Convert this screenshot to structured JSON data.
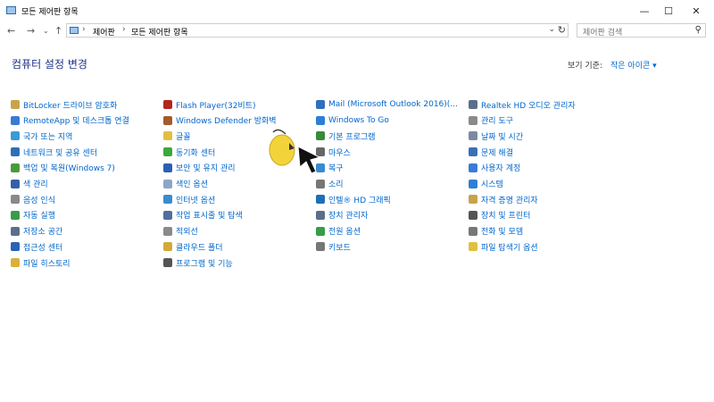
{
  "window": {
    "title": "모든 제어판 항목",
    "minimize": "—",
    "maximize": "☐",
    "close": "✕"
  },
  "address": {
    "crumbs": [
      "제어판",
      "모든 제어판 항목"
    ]
  },
  "search": {
    "placeholder": "제어판 검색"
  },
  "main": {
    "heading": "컴퓨터 설정 변경",
    "view_by_label": "보기 기준:",
    "view_by_value": "작은 아이콘 ▾"
  },
  "columns": [
    {
      "items": [
        {
          "label": "BitLocker 드라이브 암호화",
          "icon": "bitlocker-icon",
          "color": "#c8a34a"
        },
        {
          "label": "RemoteApp 및 데스크톱 연결",
          "icon": "remoteapp-icon",
          "color": "#3a7bd5"
        },
        {
          "label": "국가 또는 지역",
          "icon": "globe-icon",
          "color": "#3b9bd6"
        },
        {
          "label": "네트워크 및 공유 센터",
          "icon": "network-icon",
          "color": "#2f6fb8"
        },
        {
          "label": "백업 및 복원(Windows 7)",
          "icon": "backup-icon",
          "color": "#4a9a3c"
        },
        {
          "label": "색 관리",
          "icon": "color-management-icon",
          "color": "#3560a8"
        },
        {
          "label": "음성 인식",
          "icon": "microphone-icon",
          "color": "#8a8a8a"
        },
        {
          "label": "자동 실행",
          "icon": "autoplay-icon",
          "color": "#3a9b4a"
        },
        {
          "label": "저장소 공간",
          "icon": "storage-spaces-icon",
          "color": "#5b6f8a"
        },
        {
          "label": "접근성 센터",
          "icon": "ease-of-access-icon",
          "color": "#2a62b8"
        },
        {
          "label": "파일 히스토리",
          "icon": "file-history-icon",
          "color": "#d9b13a"
        }
      ]
    },
    {
      "items": [
        {
          "label": "Flash Player(32비트)",
          "icon": "flash-icon",
          "color": "#b3261e"
        },
        {
          "label": "Windows Defender 방화벽",
          "icon": "firewall-icon",
          "color": "#a65a2a"
        },
        {
          "label": "글꼴",
          "icon": "fonts-icon",
          "color": "#e0c040"
        },
        {
          "label": "동기화 센터",
          "icon": "sync-center-icon",
          "color": "#3ea83a"
        },
        {
          "label": "보안 및 유지 관리",
          "icon": "flag-icon",
          "color": "#2b5fb4"
        },
        {
          "label": "색인 옵션",
          "icon": "indexing-icon",
          "color": "#8da6c8"
        },
        {
          "label": "인터넷 옵션",
          "icon": "internet-options-icon",
          "color": "#3c8bd0"
        },
        {
          "label": "작업 표시줄 및 탐색",
          "icon": "taskbar-icon",
          "color": "#4f6f9f"
        },
        {
          "label": "적외선",
          "icon": "infrared-icon",
          "color": "#8a8a8a"
        },
        {
          "label": "클라우드 폴더",
          "icon": "work-folders-icon",
          "color": "#d4a93b"
        },
        {
          "label": "프로그램 및 기능",
          "icon": "programs-icon",
          "color": "#555555"
        }
      ]
    },
    {
      "items": [
        {
          "label": "Mail (Microsoft Outlook 2016)(...",
          "icon": "mail-icon",
          "color": "#2f6fbf"
        },
        {
          "label": "Windows To Go",
          "icon": "windows-to-go-icon",
          "color": "#2d7fd6"
        },
        {
          "label": "기본 프로그램",
          "icon": "default-programs-icon",
          "color": "#3a8a3a"
        },
        {
          "label": "마우스",
          "icon": "mouse-icon",
          "color": "#666666"
        },
        {
          "label": "복구",
          "icon": "recovery-icon",
          "color": "#3a8ad0"
        },
        {
          "label": "소리",
          "icon": "sound-icon",
          "color": "#777777"
        },
        {
          "label": "인텔® HD 그래픽",
          "icon": "intel-graphics-icon",
          "color": "#1f6fb8"
        },
        {
          "label": "장치 관리자",
          "icon": "device-manager-icon",
          "color": "#5b6f8a"
        },
        {
          "label": "전원 옵션",
          "icon": "power-options-icon",
          "color": "#3a9b4a"
        },
        {
          "label": "키보드",
          "icon": "keyboard-icon",
          "color": "#777777"
        }
      ]
    },
    {
      "items": [
        {
          "label": "Realtek HD 오디오 관리자",
          "icon": "realtek-audio-icon",
          "color": "#5b6f8a"
        },
        {
          "label": "관리 도구",
          "icon": "admin-tools-icon",
          "color": "#8a8a8a"
        },
        {
          "label": "날짜 및 시간",
          "icon": "date-time-icon",
          "color": "#7a8aa0"
        },
        {
          "label": "문제 해결",
          "icon": "troubleshooting-icon",
          "color": "#3a6fb8"
        },
        {
          "label": "사용자 계정",
          "icon": "user-accounts-icon",
          "color": "#3a7bd5"
        },
        {
          "label": "시스템",
          "icon": "system-icon",
          "color": "#2d7fd6"
        },
        {
          "label": "자격 증명 관리자",
          "icon": "credential-manager-icon",
          "color": "#c8a34a"
        },
        {
          "label": "장치 및 프린터",
          "icon": "devices-printers-icon",
          "color": "#555555"
        },
        {
          "label": "전화 및 모뎀",
          "icon": "phone-modem-icon",
          "color": "#777777"
        },
        {
          "label": "파일 탐색기 옵션",
          "icon": "folder-options-icon",
          "color": "#e0c040"
        }
      ]
    }
  ]
}
